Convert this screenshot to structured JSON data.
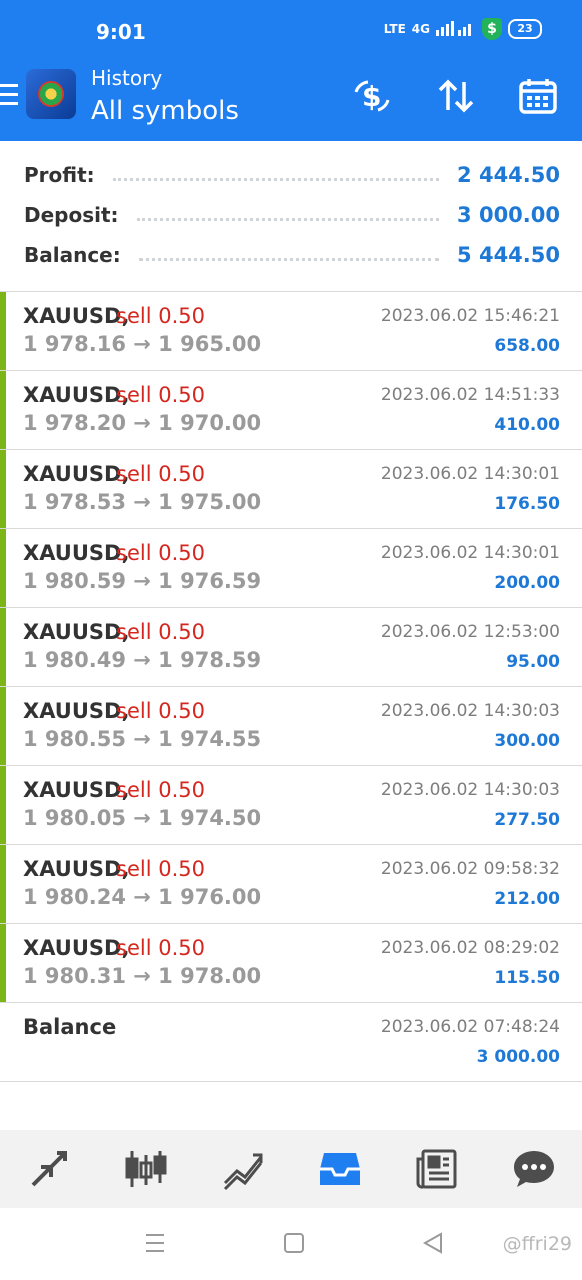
{
  "status": {
    "time": "9:01",
    "network": "4G",
    "volte": "LTE",
    "battery": "23"
  },
  "header": {
    "subtitle": "History",
    "title": "All symbols",
    "bg_color": "#1f7ef0",
    "icons": [
      "currency-exchange-icon",
      "sort-icon",
      "calendar-icon"
    ]
  },
  "summary": [
    {
      "label": "Profit:",
      "value": "2 444.50"
    },
    {
      "label": "Deposit:",
      "value": "3 000.00"
    },
    {
      "label": "Balance:",
      "value": "5 444.50"
    }
  ],
  "trades": [
    {
      "symbol": "XAUUSD,",
      "side": "sell 0.50",
      "prices": "1 978.16 → 1 965.00",
      "time": "2023.06.02 15:46:21",
      "profit": "658.00"
    },
    {
      "symbol": "XAUUSD,",
      "side": "sell 0.50",
      "prices": "1 978.20 → 1 970.00",
      "time": "2023.06.02 14:51:33",
      "profit": "410.00"
    },
    {
      "symbol": "XAUUSD,",
      "side": "sell 0.50",
      "prices": "1 978.53 → 1 975.00",
      "time": "2023.06.02 14:30:01",
      "profit": "176.50"
    },
    {
      "symbol": "XAUUSD,",
      "side": "sell 0.50",
      "prices": "1 980.59 → 1 976.59",
      "time": "2023.06.02 14:30:01",
      "profit": "200.00"
    },
    {
      "symbol": "XAUUSD,",
      "side": "sell 0.50",
      "prices": "1 980.49 → 1 978.59",
      "time": "2023.06.02 12:53:00",
      "profit": "95.00"
    },
    {
      "symbol": "XAUUSD,",
      "side": "sell 0.50",
      "prices": "1 980.55 → 1 974.55",
      "time": "2023.06.02 14:30:03",
      "profit": "300.00"
    },
    {
      "symbol": "XAUUSD,",
      "side": "sell 0.50",
      "prices": "1 980.05 → 1 974.50",
      "time": "2023.06.02 14:30:03",
      "profit": "277.50"
    },
    {
      "symbol": "XAUUSD,",
      "side": "sell 0.50",
      "prices": "1 980.24 → 1 976.00",
      "time": "2023.06.02 09:58:32",
      "profit": "212.00"
    },
    {
      "symbol": "XAUUSD,",
      "side": "sell 0.50",
      "prices": "1 980.31 → 1 978.00",
      "time": "2023.06.02 08:29:02",
      "profit": "115.50"
    }
  ],
  "balance_entry": {
    "label": "Balance",
    "time": "2023.06.02 07:48:24",
    "value": "3 000.00"
  },
  "tabbar": {
    "items": [
      "trade-arrows-icon",
      "candlestick-chart-icon",
      "trend-chart-icon",
      "history-inbox-icon",
      "news-icon",
      "messages-icon"
    ],
    "active": "history-inbox-icon"
  },
  "watermark": "@ffri29",
  "colors": {
    "accent": "#1f7ef0",
    "profit": "#1e78d6",
    "sell": "#d4271f",
    "trade_bar": "#7cb518"
  }
}
